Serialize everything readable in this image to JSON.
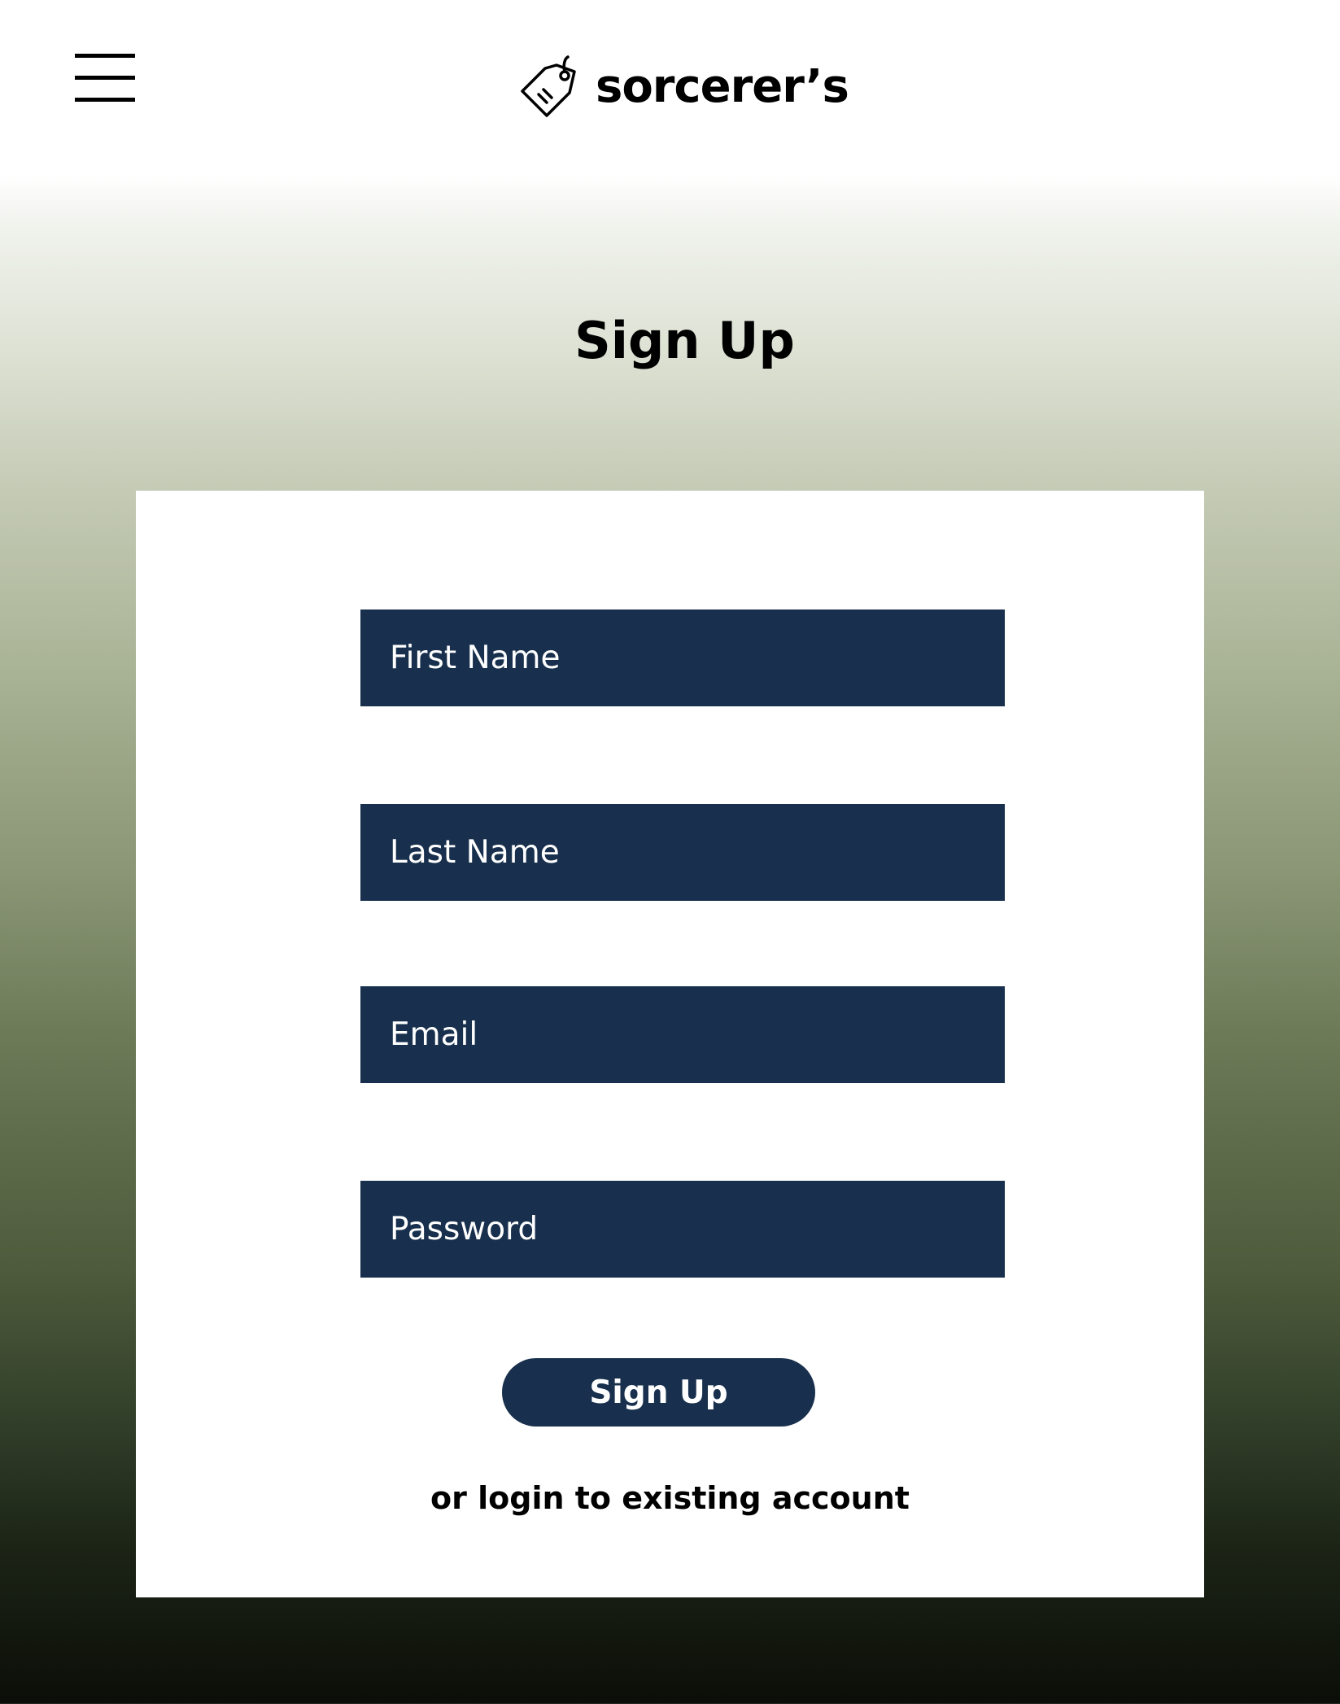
{
  "header": {
    "menu_icon": "hamburger-menu-icon",
    "logo_icon": "price-tag-icon",
    "logo_text": "sorcerer’s"
  },
  "page": {
    "title": "Sign Up"
  },
  "form": {
    "first_name": {
      "placeholder": "First Name",
      "value": ""
    },
    "last_name": {
      "placeholder": "Last Name",
      "value": ""
    },
    "email": {
      "placeholder": "Email",
      "value": ""
    },
    "password": {
      "placeholder": "Password",
      "value": ""
    },
    "submit_label": "Sign Up",
    "login_link": "or login to existing account"
  },
  "colors": {
    "field_background": "#18304d",
    "button_background": "#18304d",
    "gradient_top": "#ffffff",
    "gradient_bottom": "#0b0e08"
  }
}
